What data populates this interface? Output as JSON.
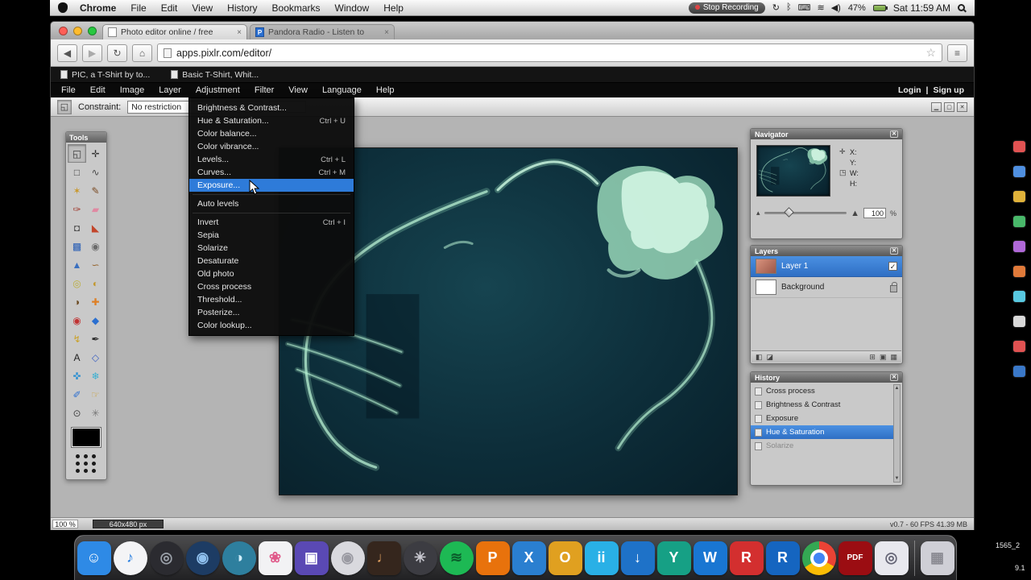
{
  "mac_menubar": {
    "items": [
      "Chrome",
      "File",
      "Edit",
      "View",
      "History",
      "Bookmarks",
      "Window",
      "Help"
    ],
    "status": {
      "stop_recording": "Stop Recording",
      "battery_pct": "47%",
      "clock": "Sat 11:59 AM"
    },
    "status_icons": [
      {
        "name": "sync-icon",
        "glyph": "↻"
      },
      {
        "name": "bluetooth-icon",
        "glyph": "ᛒ"
      },
      {
        "name": "keyboard-icon",
        "glyph": "⌨"
      },
      {
        "name": "wifi-icon",
        "glyph": "≋"
      },
      {
        "name": "volume-icon",
        "glyph": "◀)"
      }
    ]
  },
  "browser": {
    "tabs": [
      {
        "title": "Photo editor online / free",
        "favicon": "page",
        "close": "×"
      },
      {
        "title": "Pandora Radio - Listen to",
        "favicon": "P",
        "close": "×"
      }
    ],
    "nav": {
      "back": "◀",
      "forward": "▶",
      "reload": "↻",
      "home": "⌂"
    },
    "omnibox": {
      "url": "apps.pixlr.com/editor/",
      "star": "☆"
    },
    "menu_button": "≡",
    "bookmarks": [
      {
        "label": "PIC, a T-Shirt by to..."
      },
      {
        "label": "Basic T-Shirt, Whit..."
      }
    ]
  },
  "pixlr": {
    "menubar": {
      "items": [
        "File",
        "Edit",
        "Image",
        "Layer",
        "Adjustment",
        "Filter",
        "View",
        "Language",
        "Help"
      ],
      "open_item": "Adjustment",
      "login": "Login",
      "divider": "|",
      "signup": "Sign up"
    },
    "adjustment_menu": {
      "items": [
        {
          "label": "Brightness & Contrast...",
          "shortcut": ""
        },
        {
          "label": "Hue & Saturation...",
          "shortcut": "Ctrl + U"
        },
        {
          "label": "Color balance...",
          "shortcut": ""
        },
        {
          "label": "Color vibrance...",
          "shortcut": ""
        },
        {
          "label": "Levels...",
          "shortcut": "Ctrl + L"
        },
        {
          "label": "Curves...",
          "shortcut": "Ctrl + M"
        },
        {
          "label": "Exposure...",
          "shortcut": "",
          "selected": true
        },
        {
          "type": "divider"
        },
        {
          "label": "Auto levels",
          "shortcut": ""
        },
        {
          "type": "divider"
        },
        {
          "label": "Invert",
          "shortcut": "Ctrl + I"
        },
        {
          "label": "Sepia",
          "shortcut": ""
        },
        {
          "label": "Solarize",
          "shortcut": ""
        },
        {
          "label": "Desaturate",
          "shortcut": ""
        },
        {
          "label": "Old photo",
          "shortcut": ""
        },
        {
          "label": "Cross process",
          "shortcut": ""
        },
        {
          "label": "Threshold...",
          "shortcut": ""
        },
        {
          "label": "Posterize...",
          "shortcut": ""
        },
        {
          "label": "Color lookup...",
          "shortcut": ""
        }
      ]
    },
    "options_bar": {
      "tool_glyph": "◱",
      "constraint_label": "Constraint:",
      "constraint_value": "No restriction"
    },
    "tools": {
      "title": "Tools",
      "foreground_color": "#000000",
      "items": [
        {
          "name": "crop-tool",
          "glyph": "◱",
          "color": "#3b3b3b",
          "selected": true
        },
        {
          "name": "move-tool",
          "glyph": "✛",
          "color": "#2d2d2d"
        },
        {
          "name": "marquee-tool",
          "glyph": "□",
          "color": "#4a4a4a"
        },
        {
          "name": "lasso-tool",
          "glyph": "∿",
          "color": "#4a4a4a"
        },
        {
          "name": "wand-tool",
          "glyph": "✶",
          "color": "#c9992e"
        },
        {
          "name": "pencil-tool",
          "glyph": "✎",
          "color": "#7a4a22"
        },
        {
          "name": "brush-tool",
          "glyph": "✑",
          "color": "#a03a2e"
        },
        {
          "name": "eraser-tool",
          "glyph": "▰",
          "color": "#e089a2"
        },
        {
          "name": "clone-stamp-tool",
          "glyph": "◘",
          "color": "#555555"
        },
        {
          "name": "bucket-tool",
          "glyph": "◣",
          "color": "#c2452a"
        },
        {
          "name": "gradient-tool",
          "glyph": "▩",
          "color": "#2a5fb5"
        },
        {
          "name": "blur-tool",
          "glyph": "◉",
          "color": "#6a6a6a"
        },
        {
          "name": "sharpen-tool",
          "glyph": "▲",
          "color": "#3a6fbf"
        },
        {
          "name": "smudge-tool",
          "glyph": "∽",
          "color": "#96642e"
        },
        {
          "name": "sponge-tool",
          "glyph": "◎",
          "color": "#bcae3c"
        },
        {
          "name": "dodge-tool",
          "glyph": "◐",
          "color": "#c2982e"
        },
        {
          "name": "burn-tool",
          "glyph": "◑",
          "color": "#6b4a22"
        },
        {
          "name": "bandage-tool",
          "glyph": "✚",
          "color": "#de7f24"
        },
        {
          "name": "red-eye-tool",
          "glyph": "◉",
          "color": "#c03232"
        },
        {
          "name": "drop-tool",
          "glyph": "◆",
          "color": "#2a6fd0"
        },
        {
          "name": "bolt-tool",
          "glyph": "↯",
          "color": "#caa22a"
        },
        {
          "name": "pen-tool",
          "glyph": "✒",
          "color": "#2d2d2d"
        },
        {
          "name": "type-tool",
          "glyph": "A",
          "color": "#1f1f1f"
        },
        {
          "name": "shape-tool",
          "glyph": "◇",
          "color": "#3a5fc2"
        },
        {
          "name": "arrows-tool",
          "glyph": "✜",
          "color": "#2a8fd2"
        },
        {
          "name": "sparkle-tool",
          "glyph": "❄",
          "color": "#3ab0d2"
        },
        {
          "name": "eyedropper-tool",
          "glyph": "✐",
          "color": "#2d6fd0"
        },
        {
          "name": "hand-tool",
          "glyph": "☞",
          "color": "#caa23a"
        },
        {
          "name": "zoom-tool",
          "glyph": "⊙",
          "color": "#444444"
        },
        {
          "name": "more-tool",
          "glyph": "✳",
          "color": "#777777"
        }
      ]
    },
    "navigator": {
      "title": "Navigator",
      "fields": [
        {
          "label": "X:",
          "value": ""
        },
        {
          "label": "Y:",
          "value": ""
        },
        {
          "label": "W:",
          "value": ""
        },
        {
          "label": "H:",
          "value": ""
        }
      ],
      "zoom_value": "100",
      "zoom_unit": "%"
    },
    "layers": {
      "title": "Layers",
      "items": [
        {
          "name": "Layer 1",
          "selected": true,
          "checked": true
        },
        {
          "name": "Background",
          "selected": false,
          "locked": true
        }
      ]
    },
    "history": {
      "title": "History",
      "items": [
        {
          "label": "Cross process"
        },
        {
          "label": "Brightness & Contrast"
        },
        {
          "label": "Exposure"
        },
        {
          "label": "Hue & Saturation",
          "selected": true
        },
        {
          "label": "Solarize",
          "dimmed": true
        }
      ]
    },
    "statusbar": {
      "zoom": "100 %",
      "dimensions": "640x480 px",
      "meta": "v0.7 - 60 FPS 41.39 MB"
    }
  },
  "dock": {
    "items": [
      {
        "name": "finder",
        "shape": "tile",
        "bg": "#2e8ae6",
        "fg": "#ffffff",
        "glyph": "☺"
      },
      {
        "name": "itunes",
        "shape": "circle",
        "bg": "#f4f4f6",
        "fg": "#2a7fe0",
        "glyph": "♪"
      },
      {
        "name": "camera-lens-app",
        "shape": "circle",
        "bg": "#2b2b30",
        "fg": "#9aa0a8",
        "glyph": "◎"
      },
      {
        "name": "navy-circle-app",
        "shape": "circle",
        "bg": "#1d3c64",
        "fg": "#8fc0ee",
        "glyph": "◉"
      },
      {
        "name": "teal-circle-app",
        "shape": "circle",
        "bg": "#2e7f9e",
        "fg": "#d0eefb",
        "glyph": "◑"
      },
      {
        "name": "photos-app",
        "shape": "tile",
        "bg": "#f2f2f4",
        "fg": "#e05a8a",
        "glyph": "❀"
      },
      {
        "name": "purple-app",
        "shape": "tile",
        "bg": "#5a49b4",
        "fg": "#ffffff",
        "glyph": "▣"
      },
      {
        "name": "dvd-player",
        "shape": "circle",
        "bg": "#d9d9de",
        "fg": "#9a9aa2",
        "glyph": "◉"
      },
      {
        "name": "garageband",
        "shape": "tile",
        "bg": "#35261d",
        "fg": "#e0a060",
        "glyph": "♩"
      },
      {
        "name": "steering-wheel-app",
        "shape": "circle",
        "bg": "#3c3c42",
        "fg": "#c8c8d0",
        "glyph": "✳"
      },
      {
        "name": "spotify",
        "shape": "circle",
        "bg": "#1db954",
        "fg": "#0b5c2b",
        "glyph": "≋"
      },
      {
        "name": "app-p",
        "shape": "tile",
        "bg": "#e8720c",
        "fg": "#ffffff",
        "glyph": "P"
      },
      {
        "name": "app-x",
        "shape": "tile",
        "bg": "#2a7fd0",
        "fg": "#ffffff",
        "glyph": "X"
      },
      {
        "name": "app-o",
        "shape": "tile",
        "bg": "#e0a020",
        "fg": "#ffffff",
        "glyph": "O"
      },
      {
        "name": "app-ii",
        "shape": "tile",
        "bg": "#29b0e6",
        "fg": "#ffffff",
        "glyph": "ii"
      },
      {
        "name": "download-app",
        "shape": "tile",
        "bg": "#1e72c8",
        "fg": "#ffffff",
        "glyph": "↓"
      },
      {
        "name": "app-y",
        "shape": "tile",
        "bg": "#16a085",
        "fg": "#ffffff",
        "glyph": "Y"
      },
      {
        "name": "app-w",
        "shape": "tile",
        "bg": "#1976d2",
        "fg": "#ffffff",
        "glyph": "W"
      },
      {
        "name": "app-r-red",
        "shape": "tile",
        "bg": "#d32f2f",
        "fg": "#ffffff",
        "glyph": "R"
      },
      {
        "name": "app-r-blue",
        "shape": "tile",
        "bg": "#1565c0",
        "fg": "#ffffff",
        "glyph": "R"
      },
      {
        "name": "chrome",
        "shape": "circle",
        "bg": "#ffffff",
        "fg": "#ffffff",
        "glyph": ""
      },
      {
        "name": "acrobat",
        "shape": "tile",
        "bg": "#9b0d12",
        "fg": "#ffffff",
        "glyph": "PDF"
      },
      {
        "name": "preview-app",
        "shape": "tile",
        "bg": "#e8e8ee",
        "fg": "#666677",
        "glyph": "◎"
      },
      {
        "name": "trash",
        "shape": "tile",
        "bg": "#cfcfd6",
        "fg": "#8a8a92",
        "glyph": "▦"
      }
    ]
  },
  "desktop_strip": {
    "icons": [
      {
        "color": "#e05252"
      },
      {
        "color": "#4f8fe0"
      },
      {
        "color": "#e0b23a"
      },
      {
        "color": "#49b86a"
      },
      {
        "color": "#b068d8"
      },
      {
        "color": "#e07a3a"
      },
      {
        "color": "#58c8e0"
      },
      {
        "color": "#d8d8d8"
      },
      {
        "color": "#e05252"
      },
      {
        "color": "#3a78c8"
      }
    ],
    "labels": [
      {
        "text": "1565_2"
      },
      {
        "text": "9.1"
      }
    ]
  }
}
